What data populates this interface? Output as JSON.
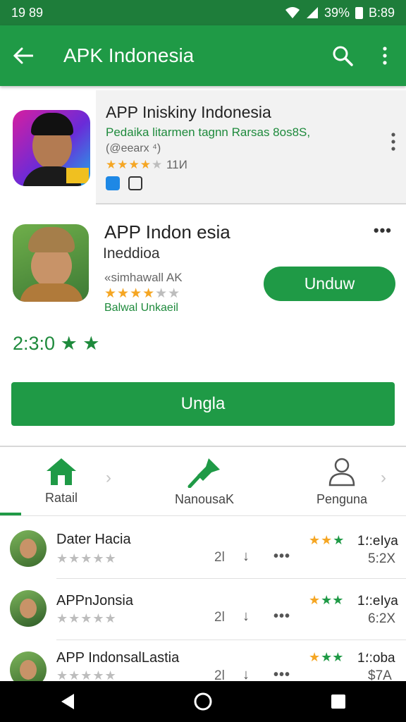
{
  "status_bar": {
    "time": "19 89",
    "battery": "39%",
    "clock": "B:89"
  },
  "app_bar": {
    "title": "APK Indonesia"
  },
  "featured": {
    "name": "APP Iniskiny Indonesia",
    "developer": "Pedaika litarmen tagnn Rarsas 8os8S,",
    "subtitle": "(@eearx ⁴)",
    "rating_count": "11И"
  },
  "app_card": {
    "name": "APP Indon esia",
    "subtitle": "Ineddioa",
    "developer": "«simhawall AK",
    "extra": "Balwal Unkaeil",
    "install_label": "Unduw",
    "score": "2:3:0",
    "big_button_label": "Ungla"
  },
  "tabs": [
    {
      "label": "Ratail",
      "icon": "home-icon"
    },
    {
      "label": "NanousaK",
      "icon": "pin-icon"
    },
    {
      "label": "Penguna",
      "icon": "person-icon"
    }
  ],
  "list": [
    {
      "title": "Dater Hacia",
      "count": "2l",
      "right_text": "؛1:eIya",
      "right_value": "5:2X"
    },
    {
      "title": "APPnJonsia",
      "count": "2l",
      "right_text": "؛1:eIya",
      "right_value": "6:2X"
    },
    {
      "title": "APP IndonsalLastia",
      "count": "2l",
      "right_text": "؛1:oba",
      "right_value": "$7A"
    }
  ],
  "colors": {
    "primary": "#1f9a46",
    "status_bar": "#1e7d3a",
    "star": "#f5a623"
  }
}
